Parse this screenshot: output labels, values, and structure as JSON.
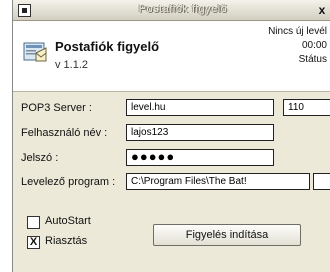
{
  "window": {
    "title": "Postafiók figyelő",
    "close_label": "x"
  },
  "header": {
    "app_name": "Postafiók figyelő",
    "version": "v 1.1.2",
    "status_message": "Nincs új levél",
    "status_time": "00:00",
    "status_label": "Státus"
  },
  "form": {
    "server_label": "POP3 Server :",
    "server_value": "level.hu",
    "port_value": "110",
    "user_label": "Felhasználó név :",
    "user_value": "lajos123",
    "password_label": "Jelszó :",
    "password_mask": "●●●●●",
    "mail_client_label": "Levelező program :",
    "mail_client_value": "C:\\Program Files\\The Bat!"
  },
  "options": {
    "autostart_label": "AutoStart",
    "autostart_checked": false,
    "alarm_label": "Riasztás",
    "alarm_checked": true,
    "check_mark": "X"
  },
  "actions": {
    "start_label": "Figyelés indítása"
  },
  "icons": {
    "app": "mailbox-envelope-icon",
    "system_menu": "system-menu-icon"
  }
}
